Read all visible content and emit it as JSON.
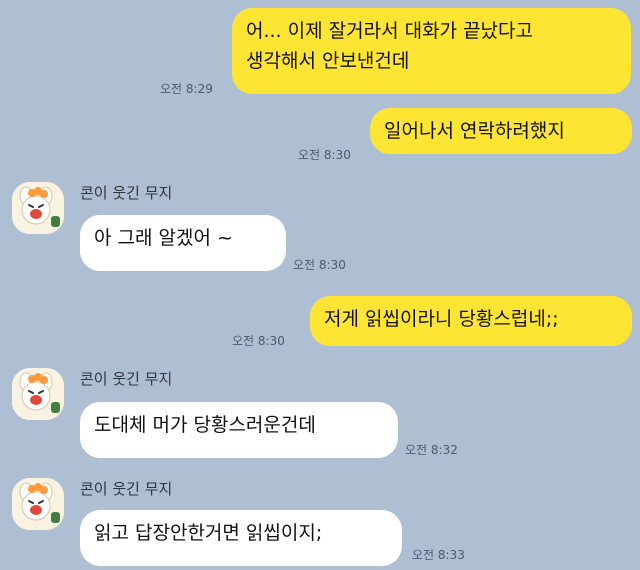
{
  "colors": {
    "background": "#aebfd3",
    "my_bubble": "#fee433",
    "their_bubble": "#ffffff"
  },
  "messages": [
    {
      "from": "me",
      "lines": [
        "어... 이제 잘거라서 대화가 끝났다고",
        "생각해서 안보낸건데"
      ],
      "time": "오전 8:29"
    },
    {
      "from": "me",
      "lines": [
        "일어나서 연락하려했지"
      ],
      "time": "오전 8:30"
    },
    {
      "from": "them",
      "sender": "콘이 웃긴 무지",
      "avatar": "muzi-con-avatar",
      "lines": [
        "아 그래 알겠어 ~"
      ],
      "time": "오전 8:30"
    },
    {
      "from": "me",
      "lines": [
        "저게 읽씹이라니 당황스럽네;;"
      ],
      "time": "오전 8:30"
    },
    {
      "from": "them",
      "sender": "콘이 웃긴 무지",
      "avatar": "muzi-con-avatar",
      "lines": [
        "도대체 머가 당황스러운건데"
      ],
      "time": "오전 8:32"
    },
    {
      "from": "them",
      "sender": "콘이 웃긴 무지",
      "avatar": "muzi-con-avatar",
      "lines": [
        "읽고 답장안한거면 읽씹이지;"
      ],
      "time": "오전 8:33"
    }
  ]
}
